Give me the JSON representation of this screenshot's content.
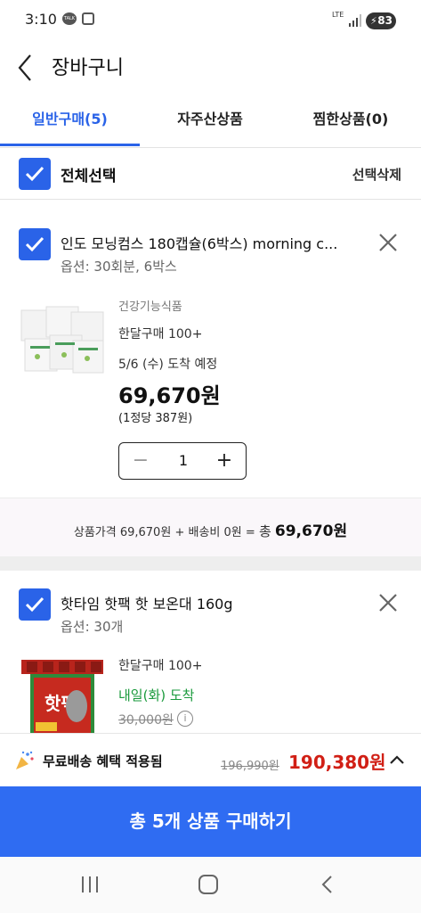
{
  "status_bar": {
    "time": "3:10",
    "talk_badge": "TALK",
    "network": "LTE",
    "battery": "83"
  },
  "header": {
    "title": "장바구니"
  },
  "tabs": [
    {
      "label": "일반구매(5)",
      "active": true
    },
    {
      "label": "자주산상품",
      "active": false
    },
    {
      "label": "찜한상품(0)",
      "active": false
    }
  ],
  "select_all": {
    "label": "전체선택",
    "delete_label": "선택삭제",
    "checked": true
  },
  "items": [
    {
      "title": "인도 모닝컴스 180캡슐(6박스) morning c...",
      "option": "옵션: 30회분, 6박스",
      "category": "건강기능식품",
      "monthly_purchase": "한달구매 100+",
      "arrival": "5/6 (수) 도착 예정",
      "price": "69,670원",
      "unit_price": "(1정당 387원)",
      "quantity": "1",
      "checked": true
    },
    {
      "title": "핫타임 핫팩 핫 보온대 160g",
      "option": "옵션: 30개",
      "monthly_purchase": "한달구매 100+",
      "arrival": "내일(화) 도착",
      "original_price": "30,000원",
      "checked": true
    }
  ],
  "summary": {
    "product_price_label": "상품가격",
    "product_price": "69,670원",
    "plus": "+",
    "shipping_label": "배송비",
    "shipping_fee": "0원",
    "equals": "=",
    "total_label": "총",
    "total": "69,670원"
  },
  "shipping_bar": {
    "label": "무료배송 혜택 적용됨",
    "original_total": "196,990원",
    "final_total": "190,380원"
  },
  "buy_button": {
    "label": "총 5개 상품 구매하기"
  },
  "colors": {
    "accent": "#2a63e8",
    "buy_button": "#2f6cf2",
    "final_price": "#d11f15",
    "arrival_green": "#1a9a3c"
  }
}
